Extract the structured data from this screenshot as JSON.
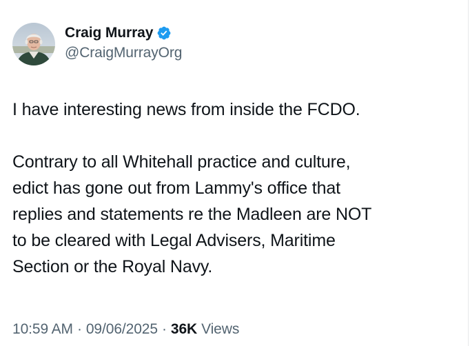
{
  "author": {
    "display_name": "Craig Murray",
    "handle": "@CraigMurrayOrg",
    "verified": true,
    "verified_color": "#1d9bf0"
  },
  "tweet": {
    "paragraphs": [
      "I have interesting news from inside the FCDO.",
      "Contrary to all Whitehall practice and culture,\nedict has gone out from Lammy's office that\nreplies and statements re the Madleen are NOT\nto be cleared with Legal Advisers, Maritime\nSection or the Royal Navy."
    ]
  },
  "meta": {
    "time": "10:59 AM",
    "separator": "·",
    "date": "09/06/2025",
    "views_count": "36K",
    "views_label": "Views"
  },
  "colors": {
    "text_primary": "#0f1419",
    "text_secondary": "#536471"
  }
}
